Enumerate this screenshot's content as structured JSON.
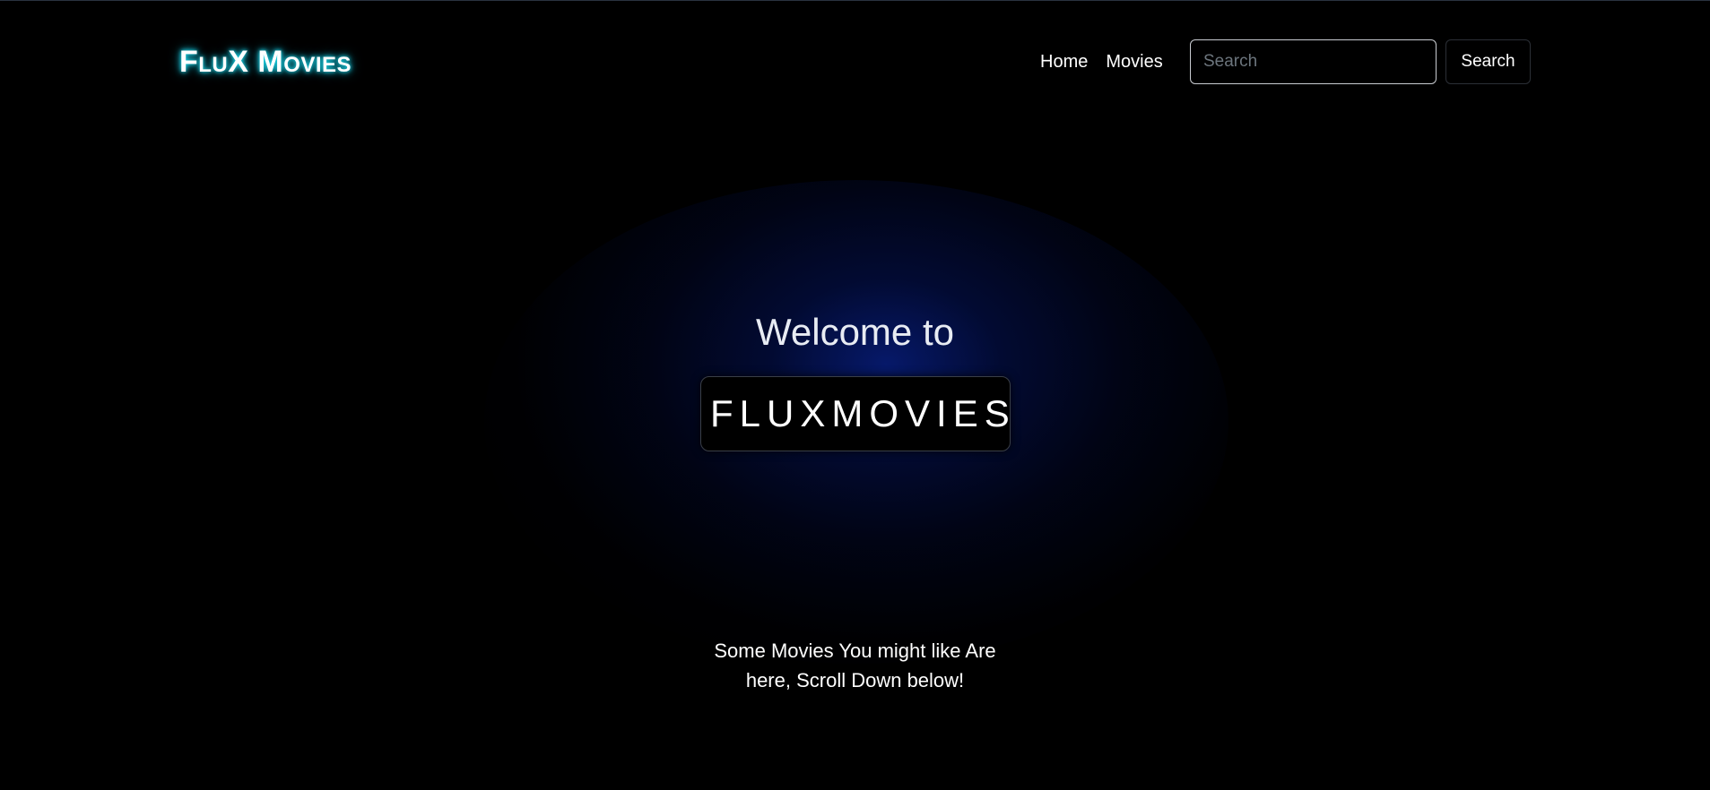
{
  "header": {
    "brand": "FluX Movies",
    "nav": [
      {
        "label": "Home"
      },
      {
        "label": "Movies"
      }
    ],
    "search": {
      "placeholder": "Search",
      "value": "",
      "button_label": "Search"
    }
  },
  "hero": {
    "welcome": "Welcome to",
    "typed_text": "FLUXMOVIES",
    "tagline_line1": "Some Movies You might like Are",
    "tagline_line2": "here, Scroll Down below!"
  },
  "colors": {
    "background": "#000000",
    "brand_glow": "#19d6e6",
    "caret": "#2a14d8",
    "hero_glow": "#0a28aa"
  }
}
